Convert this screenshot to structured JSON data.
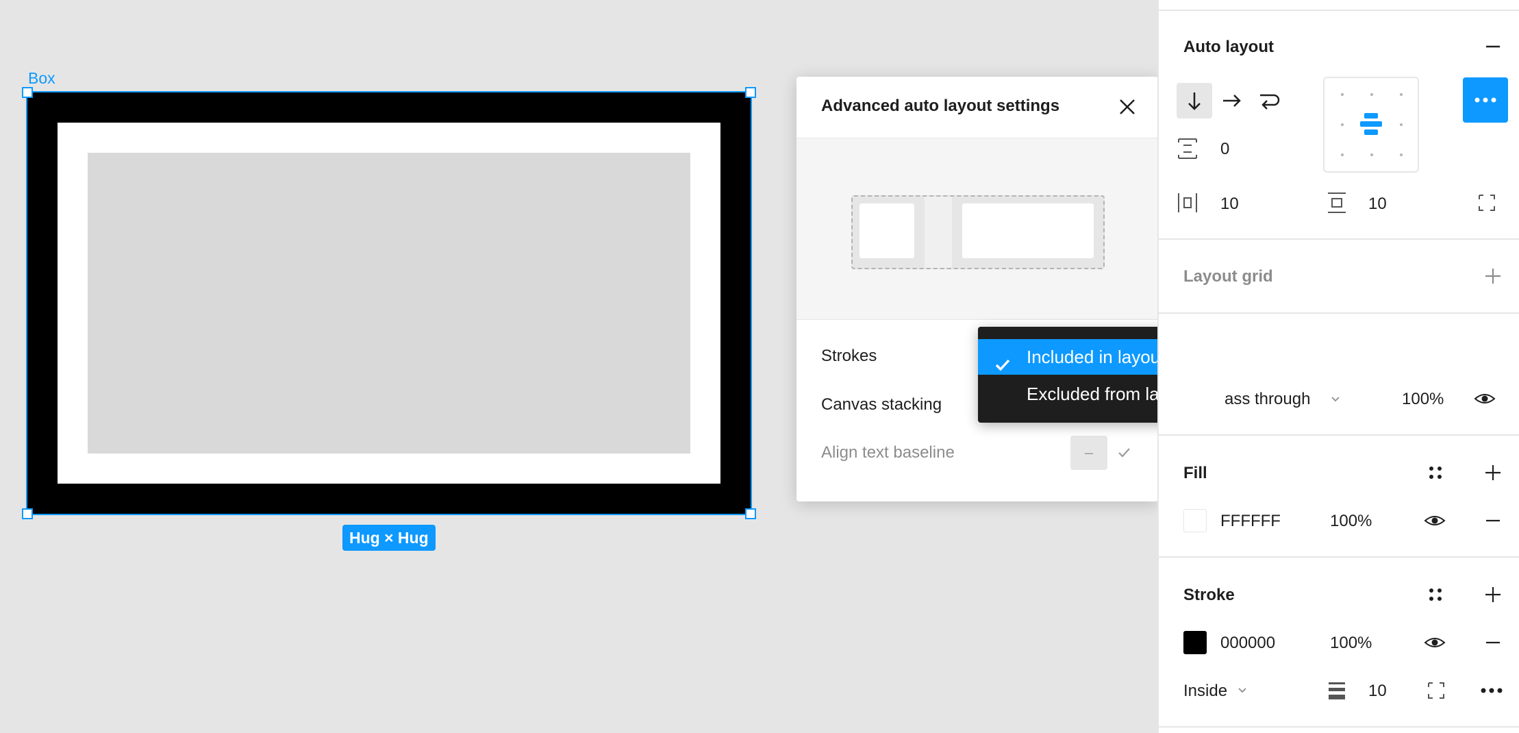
{
  "canvas": {
    "frame_label": "Box",
    "size_badge": "Hug × Hug"
  },
  "popup": {
    "title": "Advanced auto layout settings",
    "rows": {
      "strokes": "Strokes",
      "canvas_stacking": "Canvas stacking",
      "align_text_baseline": "Align text baseline",
      "baseline_toggle_value": "–"
    }
  },
  "dropdown": {
    "options": [
      "Included in layout",
      "Excluded from layout"
    ],
    "selected": "Included in layout"
  },
  "panel": {
    "auto_layout": {
      "title": "Auto layout",
      "gap": "0",
      "padding_horizontal": "10",
      "padding_vertical": "10"
    },
    "layout_grid": {
      "title": "Layout grid"
    },
    "layer": {
      "blend_mode": "ass through",
      "opacity": "100%"
    },
    "fill": {
      "title": "Fill",
      "hex": "FFFFFF",
      "opacity": "100%",
      "color": "#FFFFFF"
    },
    "stroke": {
      "title": "Stroke",
      "hex": "000000",
      "opacity": "100%",
      "color": "#000000",
      "position": "Inside",
      "weight": "10"
    }
  },
  "colors": {
    "accent": "#0D99FF",
    "menu_bg": "#1E1E1E"
  }
}
